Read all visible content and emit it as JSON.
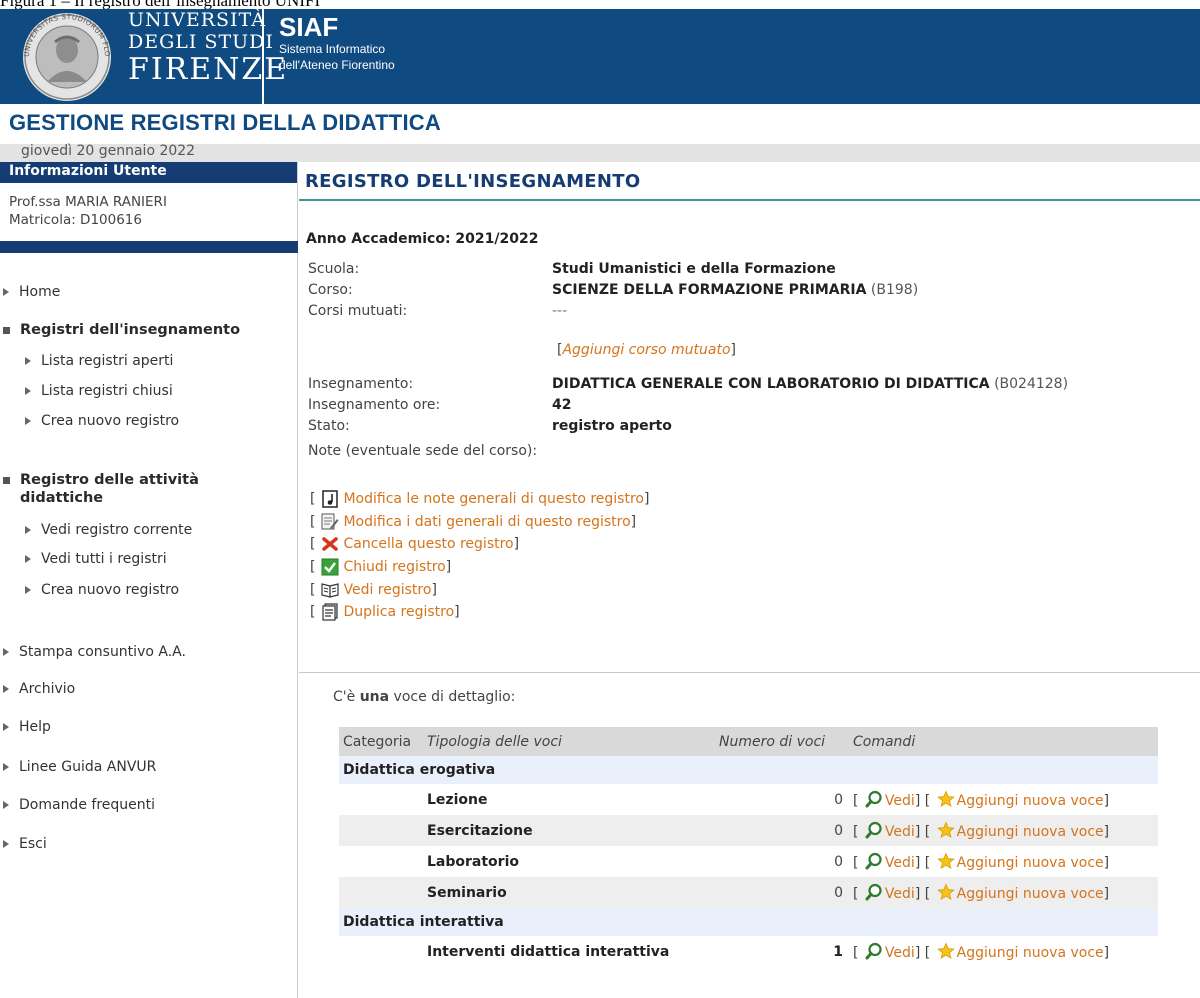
{
  "caption": "Figura 1 – Il registro dell’insegnamento UNIFI",
  "header": {
    "uni_line1": "UNIVERSITÀ",
    "uni_line2": "DEGLI STUDI",
    "uni_line3": "FIRENZE",
    "siaf_title": "SIAF",
    "siaf_sub1": "Sistema Informatico",
    "siaf_sub2": "dell'Ateneo Fiorentino",
    "seal_text": "UNIVERSITAS STUDIORUM FLORENTINA"
  },
  "app_title": "GESTIONE REGISTRI DELLA DIDATTICA",
  "date": "giovedì 20 gennaio 2022",
  "sidebar": {
    "heading": "Informazioni Utente",
    "user_name": "Prof.ssa MARIA RANIERI",
    "user_id": "Matricola: D100616",
    "menu": {
      "home": "Home",
      "registri_insegnamento": "Registri dell'insegnamento",
      "lista_aperti": "Lista registri aperti",
      "lista_chiusi": "Lista registri chiusi",
      "crea_registro_1": "Crea nuovo registro",
      "registro_attivita_1": "Registro delle attività",
      "registro_attivita_2": "didattiche",
      "vedi_corrente": "Vedi registro corrente",
      "vedi_tutti": "Vedi tutti i registri",
      "crea_registro_2": "Crea nuovo registro",
      "stampa": "Stampa consuntivo A.A.",
      "archivio": "Archivio",
      "help": "Help",
      "linee_guida": "Linee Guida ANVUR",
      "domande": "Domande frequenti",
      "esci": "Esci"
    }
  },
  "main": {
    "title": "REGISTRO DELL'INSEGNAMENTO",
    "anno": "Anno Accademico: 2021/2022",
    "labels": {
      "scuola": "Scuola:",
      "corso": "Corso:",
      "mutuati": "Corsi mutuati:",
      "insegnamento": "Insegnamento:",
      "ore": "Insegnamento ore:",
      "stato": "Stato:",
      "note": "Note (eventuale sede del corso):"
    },
    "values": {
      "scuola": "Studi Umanistici e della Formazione",
      "corso": "SCIENZE DELLA FORMAZIONE PRIMARIA",
      "corso_code": "(B198)",
      "mutuati": "---",
      "aggiungi_mutuato": "Aggiungi corso mutuato",
      "insegnamento": "DIDATTICA GENERALE CON LABORATORIO DI DIDATTICA",
      "insegnamento_code": "(B024128)",
      "ore": "42",
      "stato": "registro aperto"
    },
    "commands": {
      "modifica_note": "Modifica le note generali di questo registro ",
      "modifica_dati": "Modifica i dati generali di questo registro",
      "cancella": "Cancella questo registro",
      "chiudi": "Chiudi registro",
      "vedi": "Vedi registro",
      "duplica": "Duplica registro"
    },
    "count_pre": "C'è ",
    "count_bold": "una",
    "count_post": " voce di dettaglio:",
    "table": {
      "headers": [
        "Categoria",
        "Tipologia delle voci",
        "Numero di voci",
        "Comandi"
      ],
      "groups": [
        {
          "category": "Didattica erogativa",
          "rows": [
            {
              "name": "Lezione",
              "count": "0"
            },
            {
              "name": "Esercitazione",
              "count": "0"
            },
            {
              "name": "Laboratorio",
              "count": "0"
            },
            {
              "name": "Seminario",
              "count": "0"
            }
          ]
        },
        {
          "category": "Didattica interattiva",
          "rows": [
            {
              "name": "Interventi didattica interattiva",
              "count": "1"
            }
          ]
        }
      ],
      "cmd_vedi": "Vedi",
      "cmd_aggiungi": "Aggiungi nuova voce"
    }
  },
  "colors": {
    "header_blue": "#0f4a80",
    "nav_blue": "#163d73",
    "link_orange": "#d4741c",
    "accent_teal": "#3d9a93"
  }
}
